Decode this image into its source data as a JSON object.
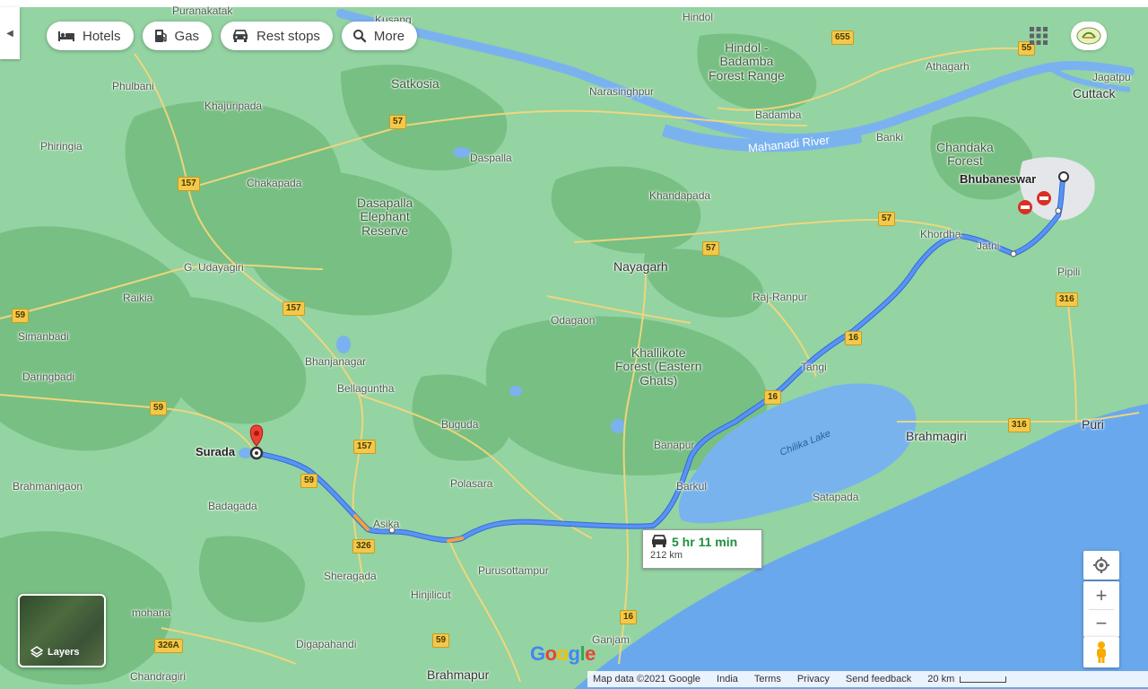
{
  "toolbar": {
    "chips": [
      {
        "label": "Hotels",
        "icon": "bed-icon"
      },
      {
        "label": "Gas",
        "icon": "gas-pump-icon"
      },
      {
        "label": "Rest stops",
        "icon": "car-icon"
      },
      {
        "label": "More",
        "icon": "search-icon"
      }
    ]
  },
  "route": {
    "duration": "5 hr 11 min",
    "distance": "212 km",
    "origin": "Surada",
    "destination": "Bhubaneswar"
  },
  "places": {
    "puranakatak": "Puranakatak",
    "kusang": "Kusang",
    "hindol": "Hindol",
    "hindol_forest": "Hindol -\nBadamba\nForest Range",
    "athagarh": "Athagarh",
    "jagatpur": "Jagatpu",
    "cuttack": "Cuttack",
    "phulbani": "Phulbani",
    "satkosia": "Satkosia",
    "narasinghpur": "Narasinghpur",
    "khajuripada": "Khajuripada",
    "badamba": "Badamba",
    "mahanadi": "Mahanadi River",
    "banki": "Banki",
    "chandaka": "Chandaka\nForest",
    "phiringia": "Phiringia",
    "daspalla": "Daspalla",
    "chakapada": "Chakapada",
    "khandapada": "Khandapada",
    "dasapalla_reserve": "Dasapalla\nElephant\nReserve",
    "khordha": "Khordha",
    "jatni": "Jatni",
    "g_udayagiri": "G. Udayagiri",
    "nayagarh": "Nayagarh",
    "pipili": "Pipili",
    "raikia": "Raikia",
    "raj_ranpur": "Raj-Ranpur",
    "simanbadi": "Simanbadi",
    "odagaon": "Odagaon",
    "khallikote": "Khallikote\nForest (Eastern\nGhats)",
    "bhanjanagar": "Bhanjanagar",
    "tangi": "Tangi",
    "daringbadi": "Daringbadi",
    "bellaguntha": "Bellaguntha",
    "buguda": "Buguda",
    "puri": "Puri",
    "brahmagiri": "Brahmagiri",
    "chilika": "Chilika Lake",
    "banapur": "Banapur",
    "barkul": "Barkul",
    "brahmanigaon": "Brahmanigaon",
    "polasara": "Polasara",
    "satapada": "Satapada",
    "badagada": "Badagada",
    "asika": "Asika",
    "purusottampur": "Purusottampur",
    "sheragada": "Sheragada",
    "hinjilicut": "Hinjilicut",
    "mohana": "mohana",
    "digapahandi": "Digapahandi",
    "ganjam": "Ganjam",
    "brahmapur": "Brahmapur",
    "chandragiri": "Chandragiri"
  },
  "shields": [
    "55",
    "655",
    "57",
    "57",
    "57",
    "157",
    "157",
    "157",
    "59",
    "59",
    "59",
    "16",
    "16",
    "16",
    "316",
    "316",
    "326",
    "326A",
    "59"
  ],
  "layers": {
    "label": "Layers"
  },
  "brand": {
    "logo": "Google"
  },
  "footer": {
    "map_data": "Map data ©2021 Google",
    "country": "India",
    "terms": "Terms",
    "privacy": "Privacy",
    "feedback": "Send feedback",
    "scale": "20 km"
  },
  "colors": {
    "land": "#8fd19e",
    "forest": "#6fba7d",
    "sea": "#6aa8ed",
    "route": "#4a85f4",
    "road": "#f7d97b",
    "duration_green": "#1e8e3e"
  }
}
